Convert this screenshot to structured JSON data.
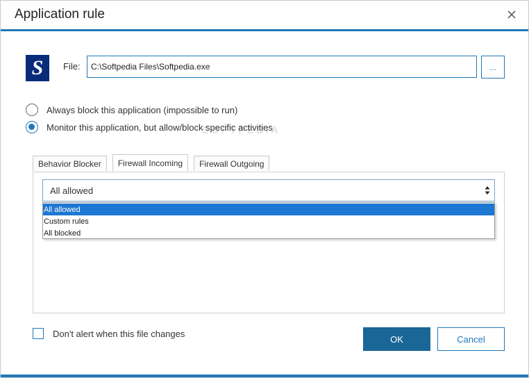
{
  "window": {
    "title": "Application rule",
    "accent_color": "#1f78b8"
  },
  "file": {
    "label": "File:",
    "value": "C:\\Softpedia Files\\Softpedia.exe",
    "browse_label": "...",
    "icon": "softpedia-app-icon",
    "icon_letter": "S"
  },
  "mode": {
    "options": [
      {
        "label": "Always block this application (impossible to run)",
        "checked": false
      },
      {
        "label": "Monitor this application, but allow/block specific activities",
        "checked": true
      }
    ]
  },
  "tabs": [
    {
      "label": "Behavior Blocker",
      "active": false
    },
    {
      "label": "Firewall Incoming",
      "active": true
    },
    {
      "label": "Firewall Outgoing",
      "active": false
    }
  ],
  "firewall_select": {
    "selected": "All allowed",
    "options": [
      {
        "label": "All allowed",
        "highlighted": true
      },
      {
        "label": "Custom rules",
        "highlighted": false
      },
      {
        "label": "All blocked",
        "highlighted": false
      }
    ]
  },
  "footer": {
    "dont_alert_label": "Don't alert when this file changes",
    "dont_alert_checked": false,
    "ok_label": "OK",
    "cancel_label": "Cancel"
  },
  "watermark": "SOFTPEDIA"
}
